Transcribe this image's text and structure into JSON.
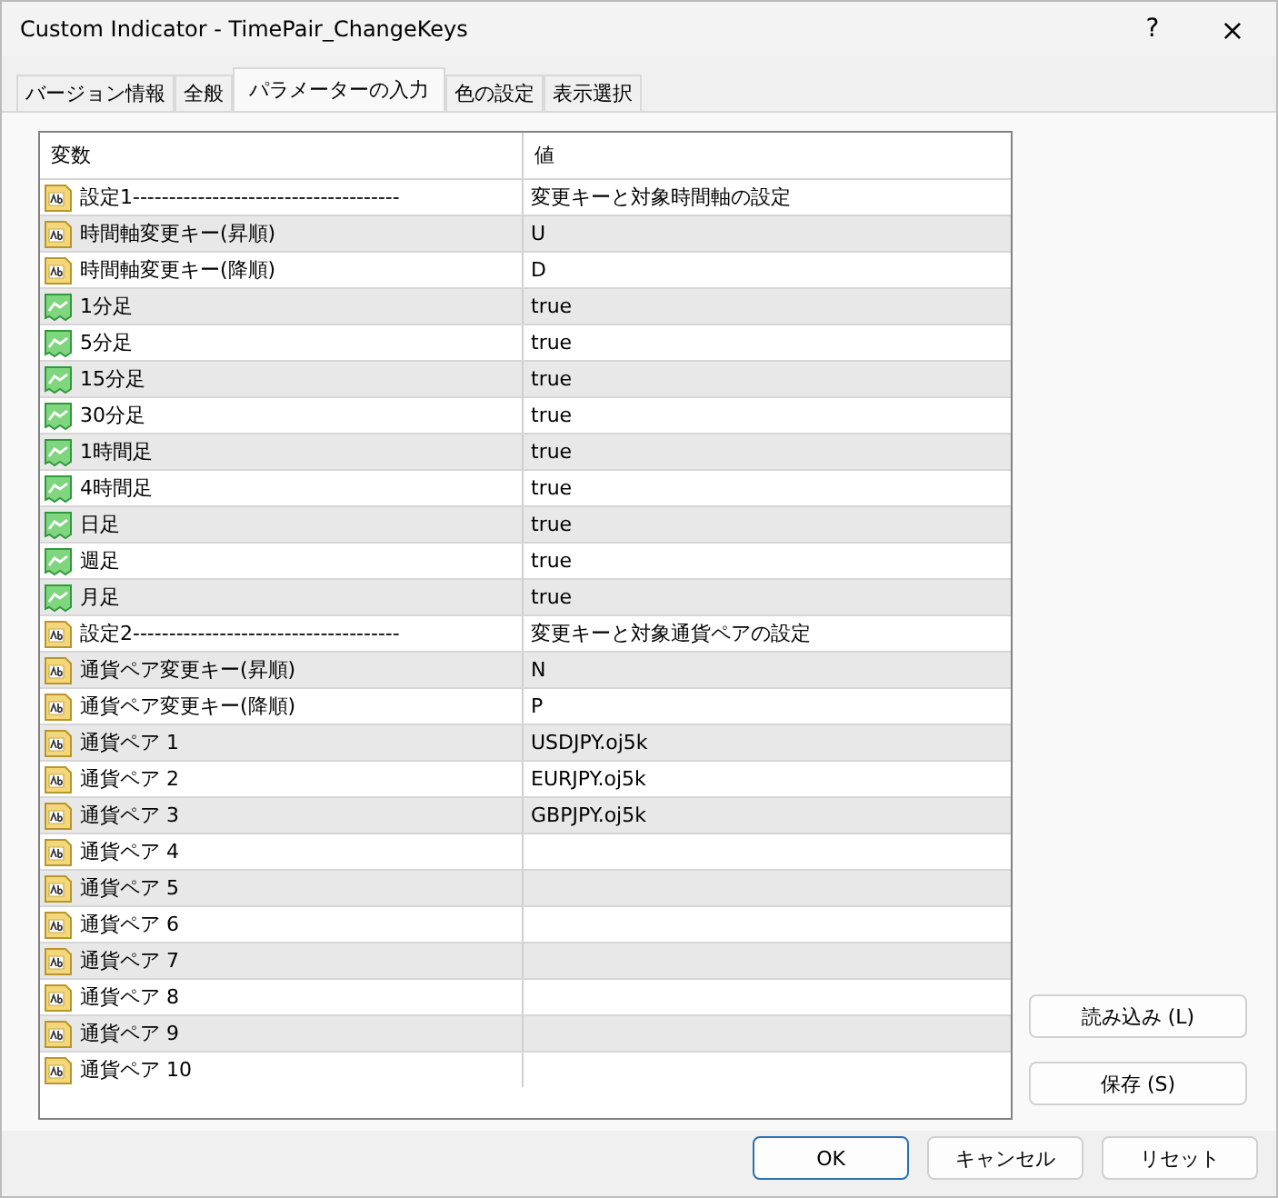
{
  "window": {
    "title": "Custom Indicator - TimePair_ChangeKeys",
    "help": "?",
    "close": "×"
  },
  "tabs": [
    {
      "label": "バージョン情報",
      "selected": false
    },
    {
      "label": "全般",
      "selected": false
    },
    {
      "label": "パラメーターの入力",
      "selected": true
    },
    {
      "label": "色の設定",
      "selected": false
    },
    {
      "label": "表示選択",
      "selected": false
    }
  ],
  "table": {
    "columns": [
      "変数",
      "値"
    ],
    "rows": [
      {
        "kind": "string",
        "name": "設定1-------------------------------------",
        "value": "変更キーと対象時間軸の設定"
      },
      {
        "kind": "string",
        "name": "時間軸変更キー(昇順)",
        "value": "U"
      },
      {
        "kind": "string",
        "name": "時間軸変更キー(降順)",
        "value": "D"
      },
      {
        "kind": "bool",
        "name": "1分足",
        "value": "true"
      },
      {
        "kind": "bool",
        "name": "5分足",
        "value": "true"
      },
      {
        "kind": "bool",
        "name": "15分足",
        "value": "true"
      },
      {
        "kind": "bool",
        "name": "30分足",
        "value": "true"
      },
      {
        "kind": "bool",
        "name": "1時間足",
        "value": "true"
      },
      {
        "kind": "bool",
        "name": "4時間足",
        "value": "true"
      },
      {
        "kind": "bool",
        "name": "日足",
        "value": "true"
      },
      {
        "kind": "bool",
        "name": "週足",
        "value": "true"
      },
      {
        "kind": "bool",
        "name": "月足",
        "value": "true"
      },
      {
        "kind": "string",
        "name": "設定2-------------------------------------",
        "value": "変更キーと対象通貨ペアの設定"
      },
      {
        "kind": "string",
        "name": "通貨ペア変更キー(昇順)",
        "value": "N"
      },
      {
        "kind": "string",
        "name": "通貨ペア変更キー(降順)",
        "value": "P"
      },
      {
        "kind": "string",
        "name": "通貨ペア 1",
        "value": "USDJPY.oj5k"
      },
      {
        "kind": "string",
        "name": "通貨ペア 2",
        "value": "EURJPY.oj5k"
      },
      {
        "kind": "string",
        "name": "通貨ペア 3",
        "value": "GBPJPY.oj5k"
      },
      {
        "kind": "string",
        "name": "通貨ペア 4"
      },
      {
        "kind": "string",
        "name": "通貨ペア 5"
      },
      {
        "kind": "string",
        "name": "通貨ペア 6"
      },
      {
        "kind": "string",
        "name": "通貨ペア 7"
      },
      {
        "kind": "string",
        "name": "通貨ペア 8"
      },
      {
        "kind": "string",
        "name": "通貨ペア 9"
      },
      {
        "kind": "string",
        "name": "通貨ペア 10"
      }
    ]
  },
  "side_buttons": [
    "読み込み (L)",
    "保存 (S)"
  ],
  "buttons": [
    {
      "label": "OK",
      "default": true
    },
    {
      "label": "キャンセル",
      "default": false
    },
    {
      "label": "リセット",
      "default": false
    }
  ]
}
